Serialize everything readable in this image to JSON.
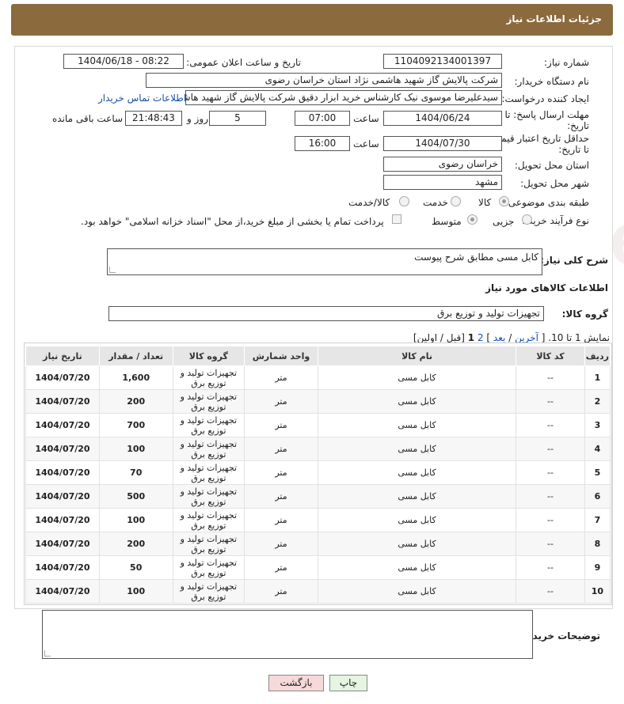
{
  "header": {
    "title": "جزئیات اطلاعات نیاز"
  },
  "form": {
    "need_number": {
      "label": "شماره نیاز:",
      "value": "1104092134001397"
    },
    "announce": {
      "label": "تاریخ و ساعت اعلان عمومی:",
      "value": "1404/06/18 - 08:22"
    },
    "buyer_org": {
      "label": "نام دستگاه خریدار:",
      "value": "شرکت پالایش گاز شهید هاشمی نژاد   استان خراسان رضوی"
    },
    "creator": {
      "label": "ایجاد کننده درخواست:",
      "value": "سیدعلیرضا موسوی نیک کارشناس خرید ابزار دقیق شرکت پالایش گاز شهید هاشمی",
      "link": "اطلاعات تماس خریدار"
    },
    "reply_deadline": {
      "label": "مهلت ارسال پاسخ: تا تاریخ:",
      "date": "1404/06/24",
      "time_label": "ساعت",
      "time": "07:00",
      "days": "5",
      "days_label": "روز و",
      "remaining": "21:48:43",
      "remaining_label": "ساعت باقی مانده"
    },
    "price_validity": {
      "label": "حداقل تاریخ اعتبار قیمت: تا تاریخ:",
      "date": "1404/07/30",
      "time_label": "ساعت",
      "time": "16:00"
    },
    "province": {
      "label": "استان محل تحویل:",
      "value": "خراسان رضوی"
    },
    "city": {
      "label": "شهر محل تحویل:",
      "value": "مشهد"
    },
    "category": {
      "label": "طبقه بندی موضوعی:",
      "options": [
        "کالا",
        "خدمت",
        "کالا/خدمت"
      ],
      "selected": "کالا"
    },
    "process": {
      "label": "نوع فرآیند خرید :",
      "options": [
        "جزیی",
        "متوسط"
      ],
      "selected": "متوسط",
      "note": "پرداخت تمام یا بخشی از مبلغ خرید،از محل \"اسناد خزانه اسلامی\" خواهد بود."
    },
    "description": {
      "label": "شرح کلی نیاز:",
      "value": "کابل مسی مطابق شرح پیوست"
    },
    "goods_section": {
      "title": "اطلاعات کالاهای مورد نیاز"
    },
    "goods_group": {
      "label": "گروه کالا:",
      "value": "تجهیزات تولید و توزیع برق"
    },
    "pagination": {
      "text_prefix": "نمایش 1 تا 10. [",
      "last": "آخرین",
      "next": "بعد",
      "page2": "2",
      "page1": "1",
      "text_suffix": "[قبل / اولین]"
    },
    "buyer_notes": {
      "label": "توضیحات خریدار:",
      "value": ""
    }
  },
  "table": {
    "headers": [
      "ردیف",
      "کد کالا",
      "نام کالا",
      "واحد شمارش",
      "گروه کالا",
      "تعداد / مقدار",
      "تاریخ نیاز"
    ],
    "rows": [
      [
        "1",
        "--",
        "کابل مسی",
        "متر",
        "تجهیزات تولید و توزیع برق",
        "1,600",
        "1404/07/20"
      ],
      [
        "2",
        "--",
        "کابل مسی",
        "متر",
        "تجهیزات تولید و توزیع برق",
        "200",
        "1404/07/20"
      ],
      [
        "3",
        "--",
        "کابل مسی",
        "متر",
        "تجهیزات تولید و توزیع برق",
        "700",
        "1404/07/20"
      ],
      [
        "4",
        "--",
        "کابل مسی",
        "متر",
        "تجهیزات تولید و توزیع برق",
        "100",
        "1404/07/20"
      ],
      [
        "5",
        "--",
        "کابل مسی",
        "متر",
        "تجهیزات تولید و توزیع برق",
        "70",
        "1404/07/20"
      ],
      [
        "6",
        "--",
        "کابل مسی",
        "متر",
        "تجهیزات تولید و توزیع برق",
        "500",
        "1404/07/20"
      ],
      [
        "7",
        "--",
        "کابل مسی",
        "متر",
        "تجهیزات تولید و توزیع برق",
        "100",
        "1404/07/20"
      ],
      [
        "8",
        "--",
        "کابل مسی",
        "متر",
        "تجهیزات تولید و توزیع برق",
        "200",
        "1404/07/20"
      ],
      [
        "9",
        "--",
        "کابل مسی",
        "متر",
        "تجهیزات تولید و توزیع برق",
        "50",
        "1404/07/20"
      ],
      [
        "10",
        "--",
        "کابل مسی",
        "متر",
        "تجهیزات تولید و توزیع برق",
        "100",
        "1404/07/20"
      ]
    ]
  },
  "buttons": {
    "print": "چاپ",
    "back": "بازگشت"
  },
  "colors": {
    "header_bg": "#8b6a3e",
    "link": "#1a4fa8",
    "back_button": "#f7d9d9",
    "print_button": "#e4f5e0"
  }
}
